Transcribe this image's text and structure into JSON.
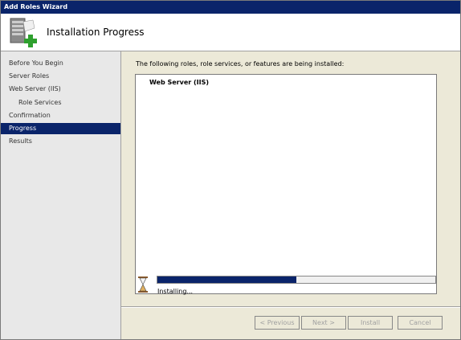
{
  "window": {
    "title": "Add Roles Wizard"
  },
  "header": {
    "title": "Installation Progress",
    "icon": "server-roles-add-icon"
  },
  "sidebar": {
    "items": [
      {
        "label": "Before You Begin",
        "active": false,
        "indent": false
      },
      {
        "label": "Server Roles",
        "active": false,
        "indent": false
      },
      {
        "label": "Web Server (IIS)",
        "active": false,
        "indent": false
      },
      {
        "label": "Role Services",
        "active": false,
        "indent": true
      },
      {
        "label": "Confirmation",
        "active": false,
        "indent": false
      },
      {
        "label": "Progress",
        "active": true,
        "indent": false
      },
      {
        "label": "Results",
        "active": false,
        "indent": false
      }
    ]
  },
  "main": {
    "intro": "The following roles, role services, or features are being installed:",
    "installing_items": [
      "Web Server (IIS)"
    ],
    "progress_fraction": 0.5,
    "status_text": "Installing..."
  },
  "buttons": {
    "previous": {
      "label": "< Previous",
      "enabled": false
    },
    "next": {
      "label": "Next >",
      "enabled": false
    },
    "install": {
      "label": "Install",
      "enabled": false
    },
    "cancel": {
      "label": "Cancel",
      "enabled": false
    }
  },
  "colors": {
    "accent": "#0a246a",
    "progress_fill": "#0a246a"
  }
}
